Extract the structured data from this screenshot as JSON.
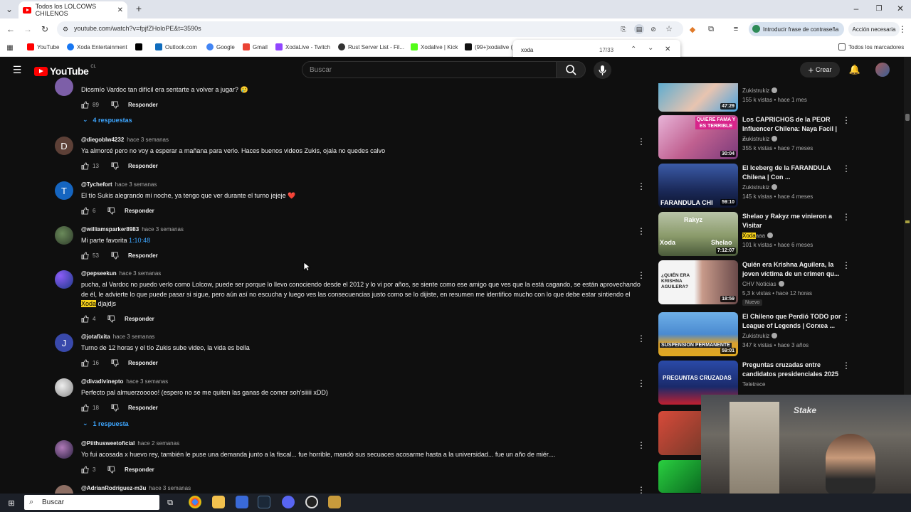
{
  "browser": {
    "tab_title": "Todos los LOLCOWS CHILENOS",
    "url": "youtube.com/watch?v=fpjfZHoloPE&t=3590s",
    "password_button": "Introducir frase de contraseña",
    "action_button": "Acción necesaria",
    "all_bookmarks": "Todos los marcadores",
    "bookmarks": [
      "YouTube",
      "Xoda Entertainment",
      "X",
      "Outlook.com",
      "Google",
      "Gmail",
      "XodaLive - Twitch",
      "Rust Server List - Fil...",
      "Xodalive | Kick",
      "(99+)xodalive ("
    ],
    "find_query": "xoda",
    "find_count": "17/33"
  },
  "youtube": {
    "logo_text": "YouTube",
    "country": "CL",
    "search_placeholder": "Buscar",
    "create_label": "Crear"
  },
  "comments": [
    {
      "text": "Diosmío Vardoc tan difícil era sentarte a volver a jugar? 🥲",
      "likes": "89",
      "reply": "Responder",
      "replies": "4 respuestas"
    },
    {
      "user": "@diegoblw4232",
      "ago": "hace 3 semanas",
      "avatar": "D",
      "text": "Ya almorcé pero no voy a esperar a mañana para verlo. Haces buenos videos Zukis, ojala no quedes calvo",
      "likes": "13",
      "reply": "Responder"
    },
    {
      "user": "@Tychefort",
      "ago": "hace 3 semanas",
      "avatar": "T",
      "text": "El tío Sukis alegrando mi noche, ya tengo que ver durante el turno jejeje ❤️",
      "likes": "6",
      "reply": "Responder"
    },
    {
      "user": "@williamsparker8983",
      "ago": "hace 3 semanas",
      "text": "Mi parte favorita",
      "timestamp": "1:10:48",
      "likes": "53",
      "reply": "Responder"
    },
    {
      "user": "@pepseekun",
      "ago": "hace 3 semanas",
      "text_a": "pucha, al Vardoc no puedo verlo como Lolcow, puede ser porque lo llevo conociendo desde el 2012 y lo vi por años, se siente como ese amigo que ves que la está cagando, se están aprovechando de él, le advierte lo que puede pasar si sigue, pero aún así no escucha y luego ves las consecuencias justo como se lo dijiste, en resumen me identifico mucho con lo que debe estar sintiendo el",
      "highlight": "Xoda",
      "text_b": "djajdjs",
      "likes": "4",
      "reply": "Responder"
    },
    {
      "user": "@jotafixita",
      "ago": "hace 3 semanas",
      "avatar": "J",
      "text": "Turno de 12 horas y el tío Zukis sube video, la vida es bella",
      "likes": "16",
      "reply": "Responder"
    },
    {
      "user": "@divadivinepto",
      "ago": "hace 3 semanas",
      "text": "Perfecto pal almuerzooooo! (espero no se me quiten las ganas de comer soh'siiiii xDD)",
      "likes": "18",
      "reply": "Responder",
      "replies": "1 respuesta"
    },
    {
      "user": "@Piithusweetoficial",
      "ago": "hace 2 semanas",
      "text": "Yo fui acosada x huevo rey, también le puse una demanda junto a la fiscal... fue horrible, mandó sus secuaces acosarme hasta a la universidad... fue un año de miér....",
      "likes": "3",
      "reply": "Responder"
    },
    {
      "user": "@AdrianRodriguez-m3u",
      "ago": "hace 3 semanas"
    }
  ],
  "recommendations": [
    {
      "title": "",
      "channel": "Zukistrukiz",
      "meta": "155 k vistas • hace 1 mes",
      "duration": "47:29"
    },
    {
      "title": "Los CAPRICHOS de la PEOR Influencer Chilena: Naya Facil | ...",
      "channel": "Zukistrukiz",
      "meta": "355 k vistas • hace 7 meses",
      "duration": "30:04",
      "thumb_text": "QUIERE FAMA Y ES TERRIBLE"
    },
    {
      "title": "El Iceberg de la FARANDULA Chilena | Con ...",
      "channel": "Zukistrukiz",
      "meta": "145 k vistas • hace 4 meses",
      "duration": "59:10",
      "thumb_text": "FARANDULA CHI"
    },
    {
      "title": "Shelao y Rakyz me vinieron a Visitar",
      "channel_hl": "Xoda",
      "channel_rest": "aaa",
      "meta": "101 k vistas • hace 6 meses",
      "duration": "7:12:07",
      "thumb_a": "Rakyz",
      "thumb_b": "Xoda",
      "thumb_c": "Shelao"
    },
    {
      "title": "Quién era Krishna Aguilera, la joven víctima de un crimen qu...",
      "channel": "CHV Noticias",
      "meta": "5,3 k vistas • hace 12 horas",
      "badge": "Nuevo",
      "duration": "18:59",
      "thumb_text": "¿QUIÉN ERA KRISHNA AGUILERA?"
    },
    {
      "title": "El Chileno que Perdió TODO por League of Legends | Corxea ...",
      "channel": "Zukistrukiz",
      "meta": "347 k vistas • hace 3 años",
      "duration": "59:01",
      "thumb_text": "SUSPENSION PERMANENTE"
    },
    {
      "title": "Preguntas cruzadas entre candidatos presidenciales 2025",
      "channel": "Teletrece",
      "thumb_text": "PREGUNTAS CRUZADAS"
    }
  ],
  "webcam": {
    "label": "Stake"
  },
  "taskbar": {
    "search": "Buscar"
  }
}
